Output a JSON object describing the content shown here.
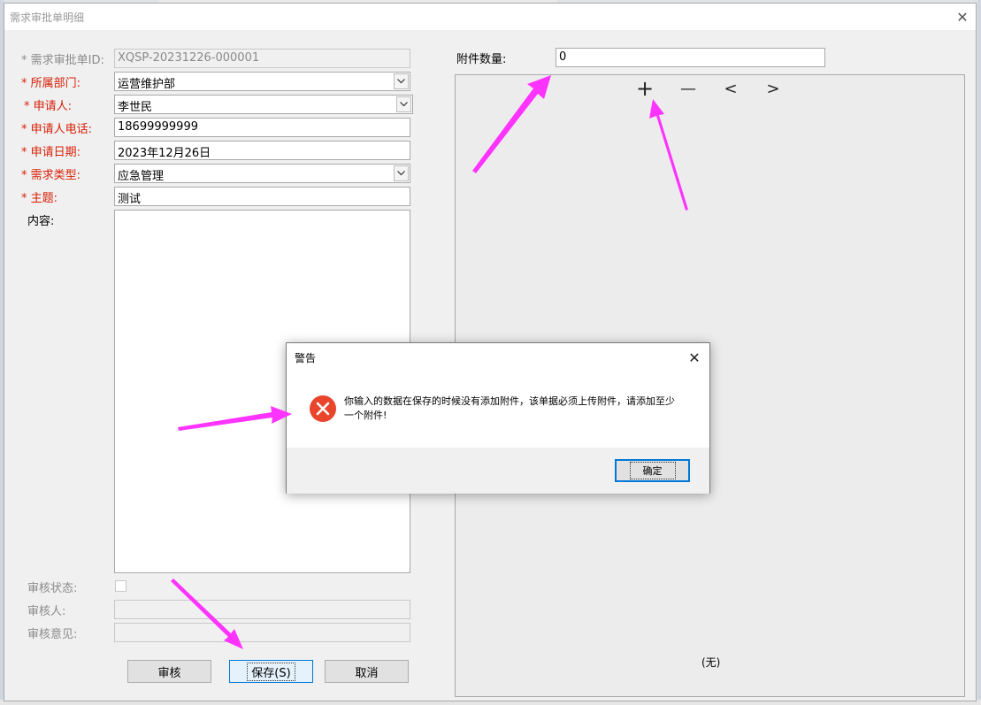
{
  "window": {
    "title": "需求审批单明细",
    "close_glyph": "✕"
  },
  "form": {
    "id_label": "* 需求审批单ID:",
    "id_value": "XQSP-20231226-000001",
    "dept_label": "* 所属部门:",
    "dept_value": "运营维护部",
    "applicant_label": "* 申请人:",
    "applicant_value": "李世民",
    "phone_label": "* 申请人电话:",
    "phone_value": "18699999999",
    "date_label": "* 申请日期:",
    "date_value": "2023年12月26日",
    "type_label": "* 需求类型:",
    "type_value": "应急管理",
    "subject_label": "* 主题:",
    "subject_value": "测试",
    "content_label": "内容:",
    "content_value": "",
    "review_status_label": "审核状态:",
    "reviewer_label": "审核人:",
    "reviewer_value": "",
    "review_opinion_label": "审核意见:",
    "review_opinion_value": ""
  },
  "buttons": {
    "review": "审核",
    "save": "保存(S)",
    "cancel": "取消"
  },
  "attachments": {
    "count_label": "附件数量:",
    "count_value": "0",
    "empty_text": "(无)",
    "add_glyph": "+",
    "remove_glyph": "—",
    "prev_glyph": "<",
    "next_glyph": ">"
  },
  "dialog": {
    "title": "警告",
    "message": "你输入的数据在保存的时候没有添加附件，该单据必须上传附件，请添加至少一个附件!",
    "ok_label": "确定",
    "close_glyph": "✕"
  },
  "colors": {
    "required_label": "#d81e06",
    "error_icon": "#e8452c",
    "annotation_arrow": "#ff33ff",
    "focus_border": "#0078d7"
  },
  "icons": {
    "error": "error-circle-icon",
    "dropdown": "chevron-down-icon"
  }
}
